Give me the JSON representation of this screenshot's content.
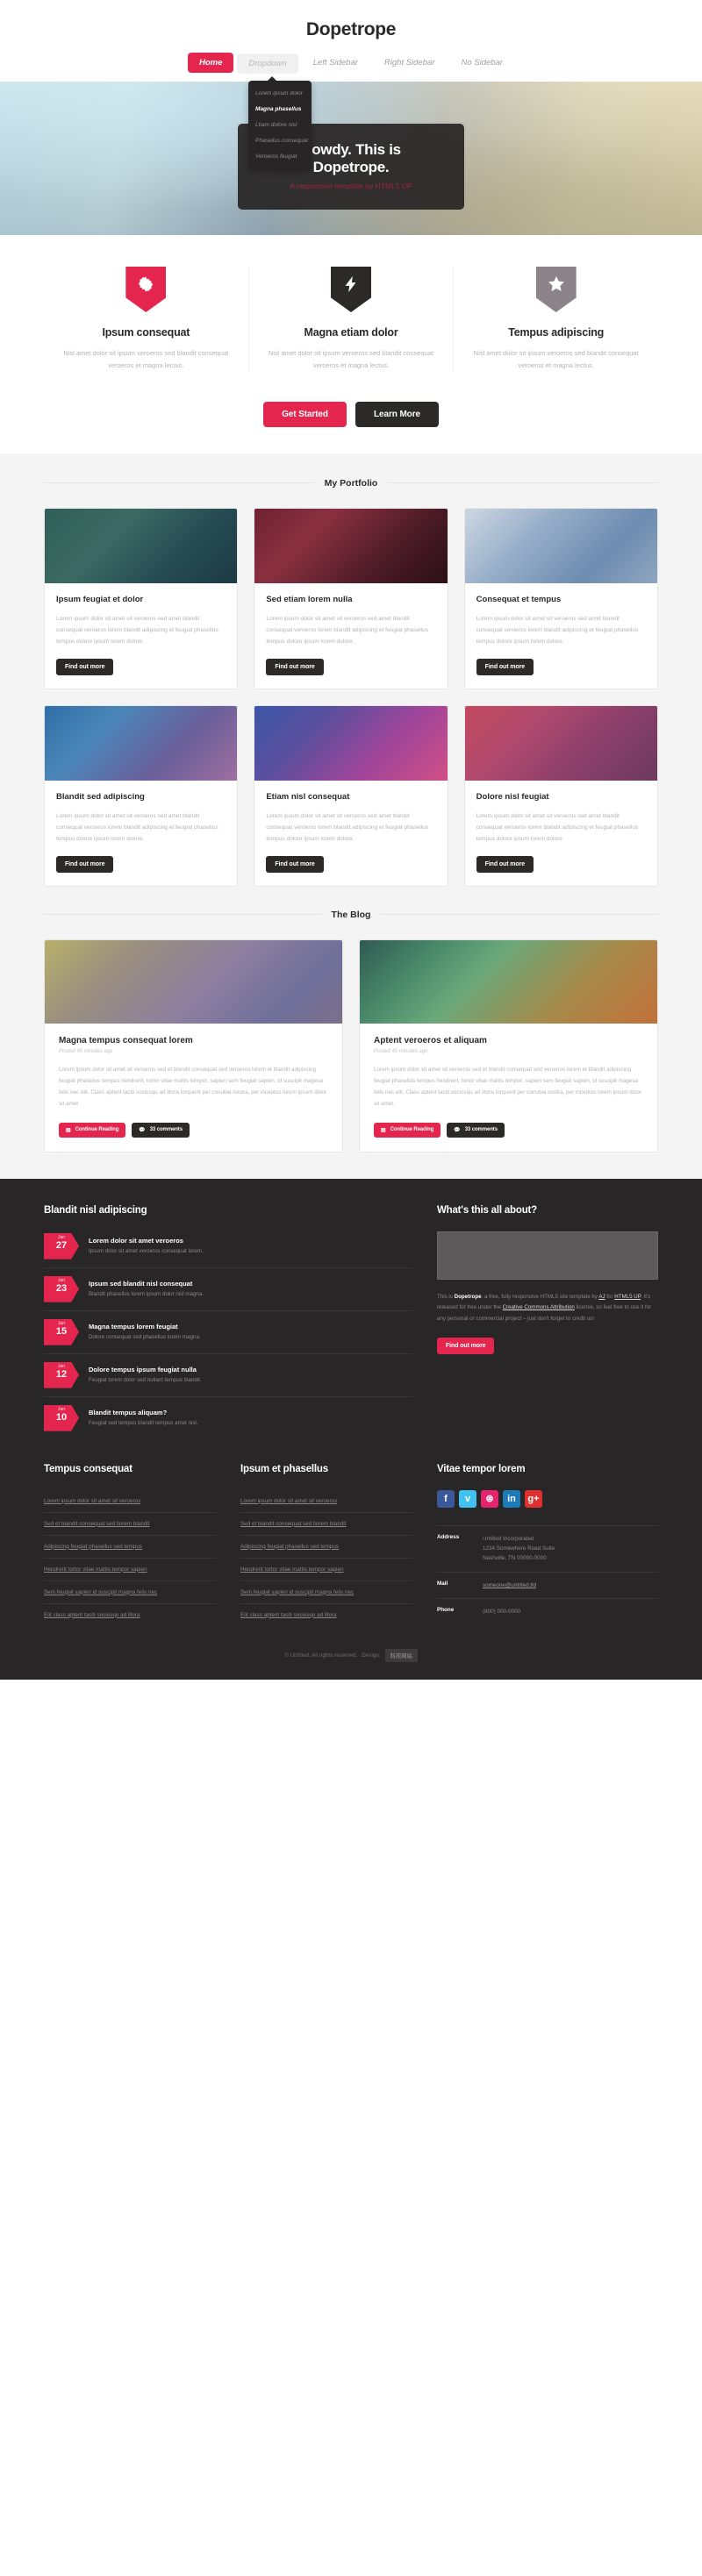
{
  "header": {
    "logo": "Dopetrope",
    "nav": [
      {
        "label": "Home",
        "state": "active"
      },
      {
        "label": "Dropdown",
        "state": "open"
      },
      {
        "label": "Left Sidebar",
        "state": "normal"
      },
      {
        "label": "Right Sidebar",
        "state": "normal"
      },
      {
        "label": "No Sidebar",
        "state": "normal"
      }
    ],
    "dropdown": [
      {
        "label": "Lorem ipsum dolor",
        "highlight": false
      },
      {
        "label": "Magna phasellus",
        "highlight": true
      },
      {
        "label": "Ltiam dolore nisl",
        "highlight": false
      },
      {
        "label": "Phasellus consequat",
        "highlight": false
      },
      {
        "label": "Veroeros feugiat",
        "highlight": false
      }
    ]
  },
  "banner": {
    "title": "Howdy. This is Dopetrope.",
    "subtitle": "A responsive template by HTML5 UP"
  },
  "features": [
    {
      "icon": "gear-icon",
      "color": "#e4264f",
      "title": "Ipsum consequat",
      "text": "Nisl amet dolor sit ipsum veroeros sed blandit consequat veroeros et magna lectus."
    },
    {
      "icon": "bolt-icon",
      "color": "#2b2a29",
      "title": "Magna etiam dolor",
      "text": "Nisl amet dolor sit ipsum veroeros sed blandit consequat veroeros et magna lectus."
    },
    {
      "icon": "star-icon",
      "color": "#8c8289",
      "title": "Tempus adipiscing",
      "text": "Nisl amet dolor sit ipsum veroeros sed blandit consequat veroeros et magna lectus."
    }
  ],
  "cta": {
    "primary": "Get Started",
    "secondary": "Learn More"
  },
  "portfolio": {
    "heading": "My Portfolio",
    "button_label": "Find out more",
    "items": [
      {
        "title": "Ipsum feugiat et dolor",
        "text": "Lorem ipsum dolor sit amet sit veroeros sed amet blandit consequat veroeros lorem blandit adipiscing et feugiat phasellus tempus dolore ipsum lorem dolore.",
        "thumb": "linear-gradient(135deg,#2f5f58 0%,#3c6a63 35%,#254a52 70%,#1d3b44 100%)"
      },
      {
        "title": "Sed etiam lorem nulla",
        "text": "Lorem ipsum dolor sit amet sit veroeros sed amet blandit consequat veroeros lorem blandit adipiscing et feugiat phasellus tempus dolore ipsum lorem dolore.",
        "thumb": "linear-gradient(135deg,#6e2232 0%,#8a3040 30%,#4a1a26 70%,#2c1018 100%)"
      },
      {
        "title": "Consequat et tempus",
        "text": "Lorem ipsum dolor sit amet sit veroeros sed amet blandit consequat veroeros lorem blandit adipiscing et feugiat phasellus tempus dolore ipsum lorem dolore.",
        "thumb": "linear-gradient(135deg,#cdd7e2 0%,#97aec9 35%,#6d8cb0 70%,#8fa6c0 100%)"
      },
      {
        "title": "Blandit sed adipiscing",
        "text": "Lorem ipsum dolor sit amet sit veroeros sed amet blandit consequat veroeros lorem blandit adipiscing et feugiat phasellus tempus dolore ipsum lorem dolore.",
        "thumb": "linear-gradient(135deg,#2f6fa8 0%,#4a86b8 30%,#6a5f9a 65%,#9f6fa0 100%)"
      },
      {
        "title": "Etiam nisl consequat",
        "text": "Lorem ipsum dolor sit amet sit veroeros sed amet blandit consequat veroeros lorem blandit adipiscing et feugiat phasellus tempus dolore ipsum lorem dolore.",
        "thumb": "linear-gradient(135deg,#3b56a8 0%,#5a4f9e 30%,#a0459a 65%,#d24f86 100%)"
      },
      {
        "title": "Dolore nisl feugiat",
        "text": "Lorem ipsum dolor sit amet sit veroeros sed amet blandit consequat veroeros lorem blandit adipiscing et feugiat phasellus tempus dolore ipsum lorem dolore.",
        "thumb": "linear-gradient(135deg,#c2495e 0%,#b24a6e 30%,#8a3f6a 65%,#6d3a5e 100%)"
      }
    ]
  },
  "blog": {
    "heading": "The Blog",
    "read_label": "Continue Reading",
    "comments_label": "33 comments",
    "posts": [
      {
        "title": "Magna tempus consequat lorem",
        "posted": "Posted 45 minutes ago",
        "text": "Lorem ipsum dolor sit amet sit veroeros sed et blandit consequat sed veroeros lorem et blandit adipiscing feugiat phasellus tempus hendrerit, tortor vitae mattis tempor, sapien sem feugiat sapien, id suscipit magesa felis nec elit. Class aptent taciti sociosqu ad litora torquent per conubia nostra, per inceptos lorem ipsum dolor sit amet.",
        "thumb": "linear-gradient(135deg,#b8b06a 0%,#9a8f7e 25%,#8d7fa0 55%,#6f6f9a 80%,#7b6f8c 100%)"
      },
      {
        "title": "Aptent veroeros et aliquam",
        "posted": "Posted 45 minutes ago",
        "text": "Lorem ipsum dolor sit amet sit veroeros sed et blandit consequat sed veroeros lorem et blandit adipiscing feugiat phasellus tempus hendrerit, tortor vitae mattis tempor, sapien sem feugiat sapien, id suscipit magesa felis nec elit. Class aptent taciti sociosqu ad litora torquent per conubia nostra, per inceptos lorem ipsum dolor sit amet.",
        "thumb": "linear-gradient(135deg,#2f5a52 0%,#4a8a6a 22%,#6aa87a 40%,#a88a4a 70%,#c2703a 100%)"
      }
    ]
  },
  "footer": {
    "news_heading": "Blandit nisl adipiscing",
    "news": [
      {
        "month": "Jan",
        "day": "27",
        "title": "Lorem dolor sit amet veroeros",
        "text": "Ipsum dolor sit amet veroeros consequat lorem."
      },
      {
        "month": "Jan",
        "day": "23",
        "title": "Ipsum sed blandit nisl consequat",
        "text": "Blandit phasellus lorem ipsum dolor nisl magna."
      },
      {
        "month": "Jan",
        "day": "15",
        "title": "Magna tempus lorem feugiat",
        "text": "Dolore consequat sed phasellus lorem magna."
      },
      {
        "month": "Jan",
        "day": "12",
        "title": "Dolore tempus ipsum feugiat nulla",
        "text": "Feugiat lorem dolor sed nullam tempus blandit."
      },
      {
        "month": "Jan",
        "day": "10",
        "title": "Blandit tempus aliquam?",
        "text": "Feugiat sed tempus blandit tempus amet nisl."
      }
    ],
    "about_heading": "What's this all about?",
    "about_text_parts": {
      "pre": "This is ",
      "brand": "Dopetrope",
      "mid1": ", a free, fully responsive HTML5 site template by ",
      "link1": "AJ",
      "mid2": " for ",
      "link2": "HTML5 UP",
      "mid3": ". It's released for free under the ",
      "link3": "Creative Commons Attribution",
      "post": " license, so feel free to use it for any personal or commercial project – just don't forget to credit us!"
    },
    "about_button": "Find out more",
    "col1_heading": "Tempus consequat",
    "col2_heading": "Ipsum et phasellus",
    "col_links": [
      "Lorem ipsum dolor sit amet sit veroeros",
      "Sed et blandit consequat sed llorem blandit",
      "Adipiscing feugiat phasellus sed tempus",
      "Hendrerit tortor vitae mattis tempor sapien",
      "Sem feugiat sapien id suscipit magna felis nec",
      "Elit class aptent taciti sociosqu ad litora"
    ],
    "contact_heading": "Vitae tempor lorem",
    "socials": [
      {
        "name": "facebook-icon",
        "glyph": "f",
        "color": "#3b5998"
      },
      {
        "name": "twitter-icon",
        "glyph": "ᴠ",
        "color": "#3fc1f2"
      },
      {
        "name": "dribbble-icon",
        "glyph": "⊛",
        "color": "#e4256d"
      },
      {
        "name": "linkedin-icon",
        "glyph": "in",
        "color": "#1b7bb9"
      },
      {
        "name": "google-plus-icon",
        "glyph": "g+",
        "color": "#e02f2f"
      }
    ],
    "contact": [
      {
        "label": "Address",
        "value": "Untitled Incorporated\n1234 Somewhere Road Suite\nNashville, TN 00000-0000",
        "link": false
      },
      {
        "label": "Mail",
        "value": "someone@untitled.tld",
        "link": true
      },
      {
        "label": "Phone",
        "value": "(800) 000-0000",
        "link": false
      }
    ],
    "copyright": "© Untitled. All rights reserved.",
    "design_label": "Design:",
    "design_chip": "科宛网站"
  }
}
